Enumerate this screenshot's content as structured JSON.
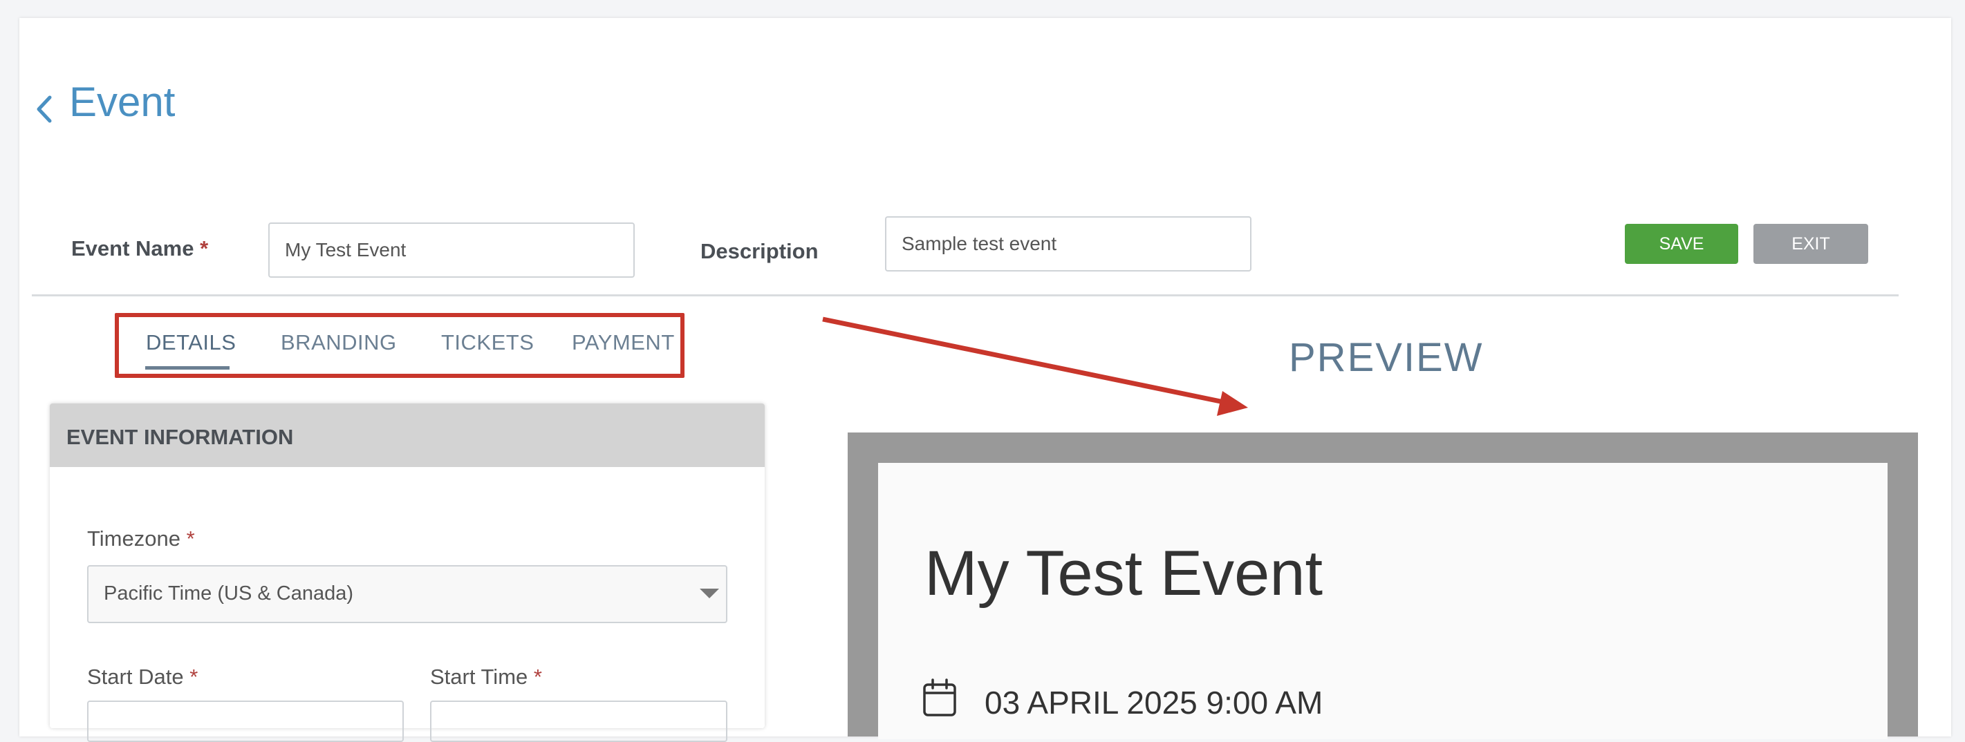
{
  "header": {
    "title": "Event"
  },
  "form": {
    "event_name_label": "Event Name",
    "required_mark": "*",
    "event_name_value": "My Test Event",
    "description_label": "Description",
    "description_value": "Sample test event"
  },
  "toolbar": {
    "save_label": "SAVE",
    "exit_label": "EXIT"
  },
  "tabs": [
    {
      "label": "DETAILS",
      "active": true
    },
    {
      "label": "BRANDING",
      "active": false
    },
    {
      "label": "TICKETS",
      "active": false
    },
    {
      "label": "PAYMENT",
      "active": false
    }
  ],
  "panel": {
    "title": "EVENT INFORMATION",
    "timezone_label": "Timezone",
    "timezone_value": "Pacific Time (US & Canada)",
    "start_date_label": "Start Date",
    "start_time_label": "Start Time"
  },
  "preview": {
    "heading": "PREVIEW",
    "event_title": "My Test Event",
    "event_datetime": "03 APRIL 2025 9:00 AM"
  },
  "colors": {
    "accent": "#4a90c2",
    "save": "#4ea23f",
    "exit": "#9b9ea2",
    "highlight": "#c8362b"
  },
  "icons": [
    "chevron-left-icon",
    "chevron-down-icon",
    "calendar-icon",
    "annotation-arrow"
  ]
}
